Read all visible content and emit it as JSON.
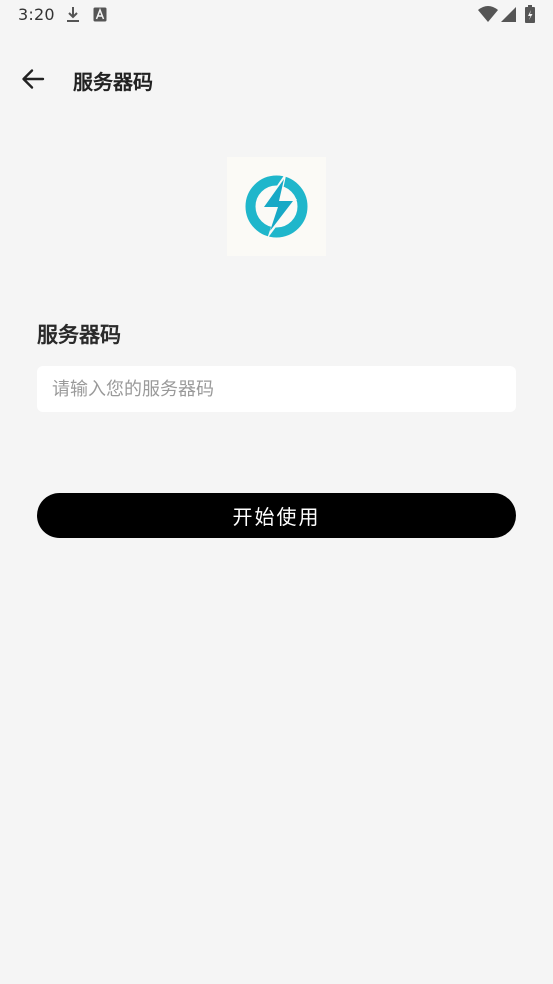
{
  "status_bar": {
    "time": "3:20",
    "icons": [
      "download-icon",
      "a-notification-icon",
      "wifi-icon",
      "cell-signal-icon",
      "battery-icon"
    ]
  },
  "app_bar": {
    "back_icon": "arrow-left-icon",
    "title": "服务器码"
  },
  "logo": {
    "icon": "lightning-bolt-logo",
    "colors": {
      "primary": "#1aaec9",
      "secondary": "#24c4c9",
      "background": "#fbfaf6"
    }
  },
  "form": {
    "label": "服务器码",
    "input_value": "",
    "input_placeholder": "请输入您的服务器码",
    "submit_label": "开始使用"
  },
  "colors": {
    "background": "#f5f5f5",
    "button": "#000000",
    "button_text": "#ffffff",
    "input_background": "#ffffff"
  }
}
